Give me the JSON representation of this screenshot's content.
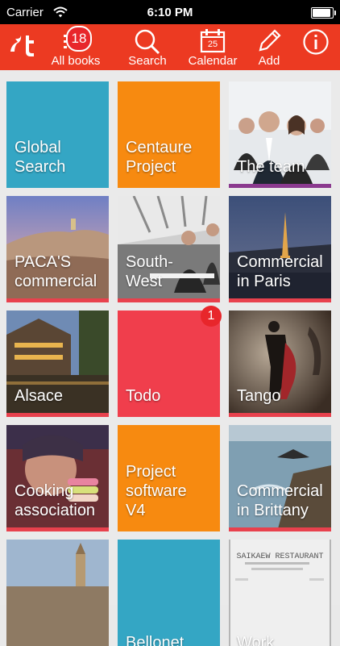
{
  "status": {
    "carrier": "Carrier",
    "time": "6:10 PM"
  },
  "toolbar": {
    "badge": "18",
    "items": [
      {
        "label": "All books",
        "icon": "list-check-icon"
      },
      {
        "label": "Search",
        "icon": "search-icon"
      },
      {
        "label": "Calendar",
        "icon": "calendar-icon",
        "day": "25"
      },
      {
        "label": "Add",
        "icon": "pencil-icon"
      },
      {
        "label": "",
        "icon": "info-icon"
      }
    ]
  },
  "tiles": [
    {
      "label": "Global\nSearch",
      "color": "#34a6c4"
    },
    {
      "label": "Centaure\nProject",
      "color": "#f78a10"
    },
    {
      "label": "The team",
      "color": "#55606a"
    },
    {
      "label": "PACA'S\ncommercial",
      "color": "#a98a7a"
    },
    {
      "label": "South-\nWest",
      "color": "#5f5f5f"
    },
    {
      "label": "Commercial\nin Paris",
      "color": "#3b4a62"
    },
    {
      "label": "Alsace",
      "color": "#4b3a2d"
    },
    {
      "label": "Todo",
      "color": "#f03e4c",
      "badge": "1"
    },
    {
      "label": "Tango",
      "color": "#3a2d28"
    },
    {
      "label": "Cooking\nassociation",
      "color": "#7a4b45"
    },
    {
      "label": "Project\nsoftware\nV4",
      "color": "#f78a10"
    },
    {
      "label": "Commercial\nin Brittany",
      "color": "#4b6a7c"
    },
    {
      "label": "",
      "color": "#8a8a8a"
    },
    {
      "label": "Bellonet",
      "color": "#34a6c4"
    },
    {
      "label": "Work",
      "color": "#d6d6d6"
    }
  ],
  "receipt": {
    "title": "SAIKAEW RESTAURANT"
  }
}
